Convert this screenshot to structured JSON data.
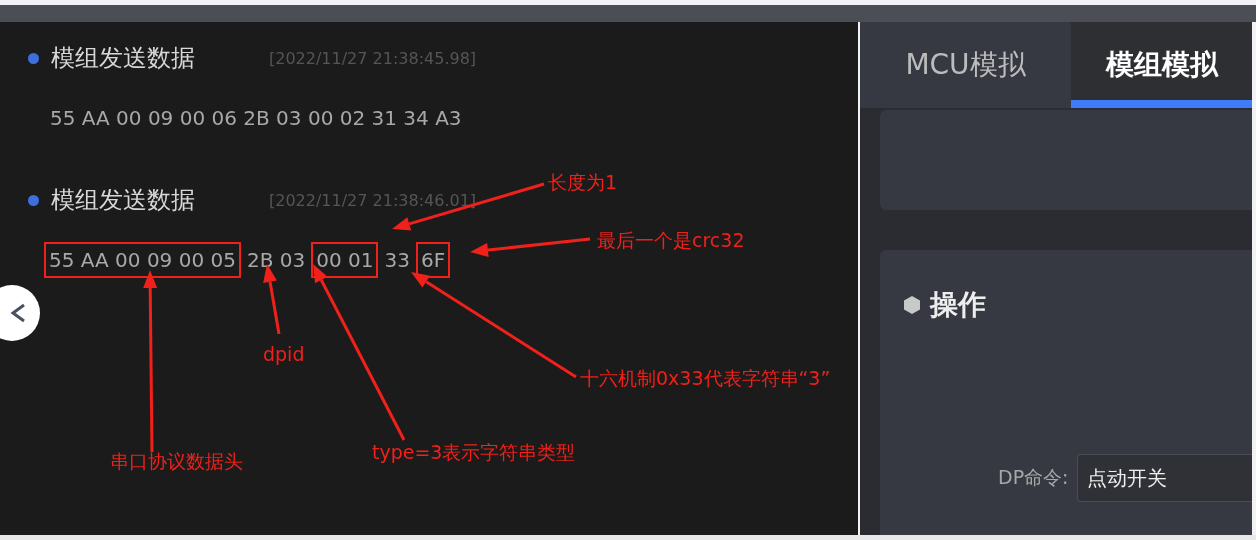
{
  "log": [
    {
      "title": "模组发送数据",
      "time": "[2022/11/27 21:38:45.98]",
      "segments": [
        {
          "text": "55 AA 00 09 00 06 2B 03 00 02 31 34 A3",
          "boxed": false
        }
      ]
    },
    {
      "title": "模组发送数据",
      "time": "[2022/11/27 21:38:46.01]",
      "segments": [
        {
          "text": "55 AA 00 09 00 05",
          "boxed": true
        },
        {
          "text": "2B 03",
          "boxed": false
        },
        {
          "text": "00 01",
          "boxed": true
        },
        {
          "text": "33",
          "boxed": false
        },
        {
          "text": "6F",
          "boxed": true
        }
      ]
    }
  ],
  "tabs": [
    {
      "label": "MCU模拟",
      "selected": false
    },
    {
      "label": "模组模拟",
      "selected": true
    }
  ],
  "operation_card": {
    "title": "操作",
    "dp_command": {
      "label": "DP命令:",
      "value": "点动开关"
    }
  },
  "annotations": [
    {
      "text": "长度为1"
    },
    {
      "text": "最后一个是crc32"
    },
    {
      "text": "dpid"
    },
    {
      "text": "十六机制0x33代表字符串“3”"
    },
    {
      "text": "串口协议数据头"
    },
    {
      "text": "type=3表示字符串类型"
    }
  ]
}
